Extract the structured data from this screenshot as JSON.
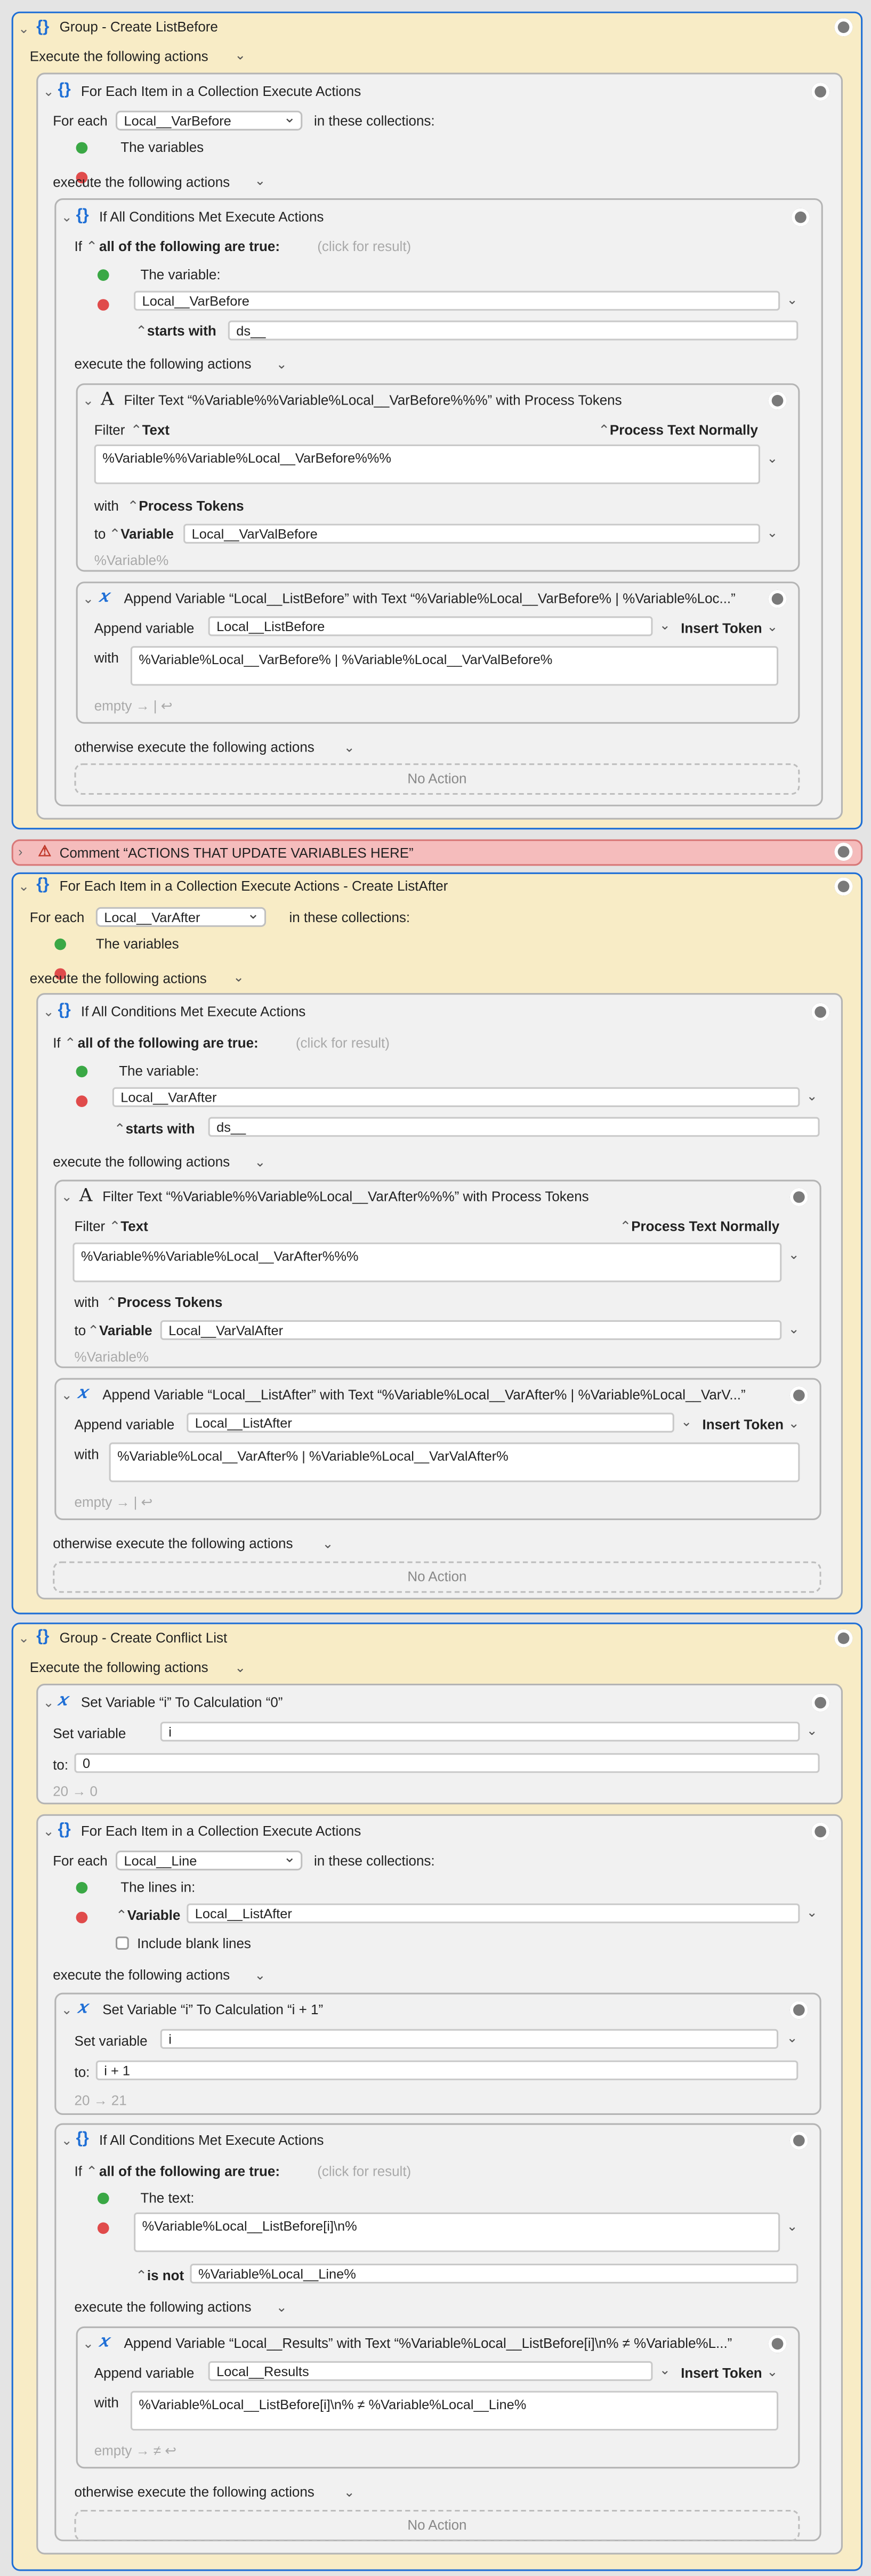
{
  "g1": {
    "title": "Group - Create ListBefore",
    "exec": "Execute the following actions",
    "fe": {
      "title": "For Each Item in a Collection Execute Actions",
      "for_each": "For each",
      "var": "Local__VarBefore",
      "in_coll": "in these collections:",
      "coll": "The variables",
      "exec": "execute the following actions",
      "ifa": {
        "title": "If All Conditions Met Execute Actions",
        "if": "If",
        "all": "all of the following are true:",
        "click": "(click for result)",
        "cond_label": "The variable:",
        "cond_var": "Local__VarBefore",
        "op": "starts with",
        "val": "ds__",
        "exec": "execute the following actions",
        "ft": {
          "title": "Filter Text “%Variable%%Variable%Local__VarBefore%%%” with Process Tokens",
          "filter": "Filter",
          "text": "Text",
          "ptn": "Process Text Normally",
          "content": "%Variable%%Variable%Local__VarBefore%%%",
          "with": "with",
          "process": "Process Tokens",
          "to": "to",
          "variable": "Variable",
          "to_var": "Local__VarValBefore",
          "result": "%Variable%"
        },
        "av": {
          "title": "Append Variable “Local__ListBefore” with Text “%Variable%Local__VarBefore% | %Variable%Loc...”",
          "label": "Append variable",
          "var": "Local__ListBefore",
          "insert": "Insert Token",
          "with": "with",
          "content": "%Variable%Local__VarBefore% | %Variable%Local__VarValBefore%",
          "result": "empty → | ↩"
        },
        "other": "otherwise execute the following actions",
        "no_action": "No Action"
      }
    }
  },
  "comment": {
    "title": "Comment “ACTIONS THAT UPDATE VARIABLES HERE”"
  },
  "g2": {
    "title": "For Each Item in a Collection Execute Actions - Create ListAfter",
    "for_each": "For each",
    "var": "Local__VarAfter",
    "in_coll": "in these collections:",
    "coll": "The variables",
    "exec": "execute the following actions",
    "ifa": {
      "title": "If All Conditions Met Execute Actions",
      "if": "If",
      "all": "all of the following are true:",
      "click": "(click for result)",
      "cond_label": "The variable:",
      "cond_var": "Local__VarAfter",
      "op": "starts with",
      "val": "ds__",
      "exec": "execute the following actions",
      "ft": {
        "title": "Filter Text “%Variable%%Variable%Local__VarAfter%%%” with Process Tokens",
        "filter": "Filter",
        "text": "Text",
        "ptn": "Process Text Normally",
        "content": "%Variable%%Variable%Local__VarAfter%%%",
        "with": "with",
        "process": "Process Tokens",
        "to": "to",
        "variable": "Variable",
        "to_var": "Local__VarValAfter",
        "result": "%Variable%"
      },
      "av": {
        "title": "Append Variable “Local__ListAfter” with Text “%Variable%Local__VarAfter% | %Variable%Local__VarV...”",
        "label": "Append variable",
        "var": "Local__ListAfter",
        "insert": "Insert Token",
        "with": "with",
        "content": "%Variable%Local__VarAfter% | %Variable%Local__VarValAfter%",
        "result": "empty → | ↩"
      },
      "other": "otherwise execute the following actions",
      "no_action": "No Action"
    }
  },
  "g3": {
    "title": "Group - Create Conflict List",
    "exec": "Execute the following actions",
    "sv": {
      "title": "Set Variable “i” To Calculation “0”",
      "label": "Set variable",
      "var": "i",
      "to": "to:",
      "val": "0",
      "result": "20 → 0"
    },
    "fe": {
      "title": "For Each Item in a Collection Execute Actions",
      "for_each": "For each",
      "var": "Local__Line",
      "in_coll": "in these collections:",
      "lines": "The lines in:",
      "variable": "Variable",
      "coll_var": "Local__ListAfter",
      "blank": "Include blank lines",
      "exec": "execute the following actions",
      "sv": {
        "title": "Set Variable “i” To Calculation “i + 1”",
        "label": "Set variable",
        "var": "i",
        "to": "to:",
        "val": "i + 1",
        "result": "20 → 21"
      },
      "ifa": {
        "title": "If All Conditions Met Execute Actions",
        "if": "If",
        "all": "all of the following are true:",
        "click": "(click for result)",
        "cond_label": "The text:",
        "cond_text": "%Variable%Local__ListBefore[i]\\n%",
        "op": "is not",
        "val": "%Variable%Local__Line%",
        "exec": "execute the following actions",
        "av": {
          "title": "Append Variable “Local__Results” with Text “%Variable%Local__ListBefore[i]\\n% ≠ %Variable%L...”",
          "label": "Append variable",
          "var": "Local__Results",
          "insert": "Insert Token",
          "with": "with",
          "content": "%Variable%Local__ListBefore[i]\\n% ≠ %Variable%Local__Line%",
          "result": "empty → ≠ ↩"
        },
        "other": "otherwise execute the following actions",
        "no_action": "No Action"
      }
    }
  }
}
